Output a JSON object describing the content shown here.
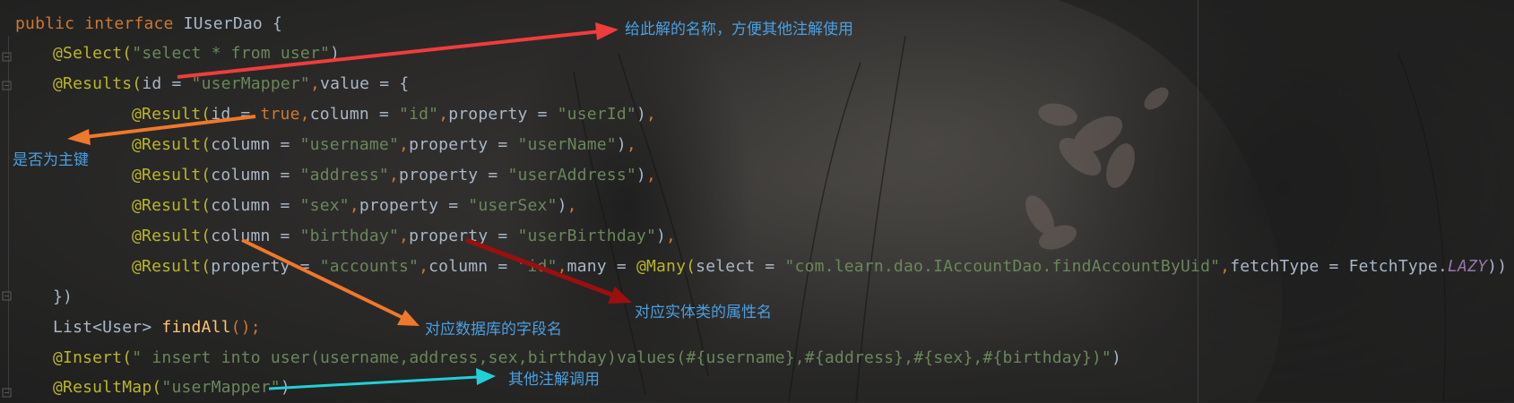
{
  "colors": {
    "keyword": "#cc7832",
    "annotation": "#bbb529",
    "string": "#6a8759",
    "plain": "#a9b7c6",
    "method": "#ffc66d",
    "constant": "#9876aa",
    "note_text": "#4a9fe0",
    "arrow_red": "#f03c3c",
    "arrow_orange": "#f0782a",
    "arrow_darkred": "#9c0f0f",
    "arrow_cyan": "#22cfd6"
  },
  "code": {
    "l1": {
      "kw": "public interface ",
      "name": "IUserDao {"
    },
    "l2": {
      "ann": "@Select(",
      "str": "\"select * from user\"",
      "close": ")"
    },
    "l3": {
      "ann": "@Results(",
      "a": "id = ",
      "str": "\"userMapper\"",
      "comma": ",",
      "b": "value = {"
    },
    "l4": {
      "ann": "@Result(",
      "a": "id = ",
      "kw": "true",
      "comma1": ",",
      "b": "column = ",
      "s1": "\"id\"",
      "comma2": ",",
      "c": "property = ",
      "s2": "\"userId\"",
      "close": ")",
      "comma3": ","
    },
    "l5": {
      "ann": "@Result(",
      "b": "column = ",
      "s1": "\"username\"",
      "comma2": ",",
      "c": "property = ",
      "s2": "\"userName\"",
      "close": ")",
      "comma3": ","
    },
    "l6": {
      "ann": "@Result(",
      "b": "column = ",
      "s1": "\"address\"",
      "comma2": ",",
      "c": "property = ",
      "s2": "\"userAddress\"",
      "close": ")",
      "comma3": ","
    },
    "l7": {
      "ann": "@Result(",
      "b": "column = ",
      "s1": "\"sex\"",
      "comma2": ",",
      "c": "property = ",
      "s2": "\"userSex\"",
      "close": ")",
      "comma3": ","
    },
    "l8": {
      "ann": "@Result(",
      "b": "column = ",
      "s1": "\"birthday\"",
      "comma2": ",",
      "c": "property = ",
      "s2": "\"userBirthday\"",
      "close": ")",
      "comma3": ","
    },
    "l9": {
      "ann": "@Result(",
      "a": "property = ",
      "s1": "\"accounts\"",
      "comma1": ",",
      "b": "column = ",
      "s2": "\"id\"",
      "comma2": ",",
      "c": "many = ",
      "ann2": "@Many(",
      "d": "select = ",
      "s3": "\"com.learn.dao.IAccountDao.findAccountByUid\"",
      "comma3": ",",
      "e": "fetchType = FetchType.",
      "const": "LAZY",
      "close": "))"
    },
    "l10": {
      "text": "})"
    },
    "l11": {
      "type": "List<User> ",
      "fn": "findAll",
      "rest": "();"
    },
    "l12": {
      "ann": "@Insert(",
      "str": "\" insert into user(username,address,sex,birthday)values(#{username},#{address},#{sex},#{birthday})\"",
      "close": ")"
    },
    "l13": {
      "ann": "@ResultMap(",
      "str": "\"userMapper\"",
      "close": ")"
    }
  },
  "annotations": {
    "name_note": "给此解的名称，方便其他注解使用",
    "primary_key_note": "是否为主键",
    "column_note": "对应数据库的字段名",
    "property_note": "对应实体类的属性名",
    "other_use_note": "其他注解调用"
  }
}
